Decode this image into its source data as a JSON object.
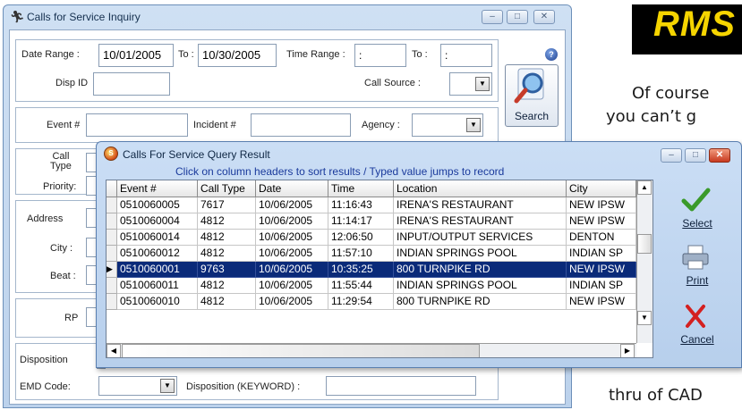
{
  "slide": {
    "banner": "RMS",
    "line1": "Of course",
    "line2": "you can’t g",
    "line3": "thru of CAD"
  },
  "main_window": {
    "title": "Calls for Service Inquiry",
    "date_range_label": "Date Range :",
    "date_from": "10/01/2005",
    "to_label": "To :",
    "date_to": "10/30/2005",
    "time_range_label": "Time Range :",
    "time_from": " :",
    "time_to_label": "To :",
    "time_to": " :",
    "disp_id_label": "Disp ID",
    "call_source_label": "Call Source :",
    "event_label": "Event #",
    "incident_label": "Incident #",
    "agency_label": "Agency :",
    "call_type_label": "Call\nType",
    "priority_label": "Priority:",
    "address_label": "Address",
    "city_label": "City :",
    "beat_label": "Beat :",
    "rp_label": "RP",
    "disposition_label": "Disposition",
    "emd_code_label": "EMD Code:",
    "disposition_keyword_label": "Disposition (KEYWORD) :",
    "search_label": "Search"
  },
  "result_window": {
    "title": "Calls For Service Query Result",
    "hint": "Click on column headers to sort results / Typed value jumps to record",
    "columns": [
      "Event #",
      "Call Type",
      "Date",
      "Time",
      "Location",
      "City"
    ],
    "rows": [
      [
        "0510060005",
        "7617",
        "10/06/2005",
        "11:16:43",
        "IRENA'S RESTAURANT",
        "NEW IPSW"
      ],
      [
        "0510060004",
        "4812",
        "10/06/2005",
        "11:14:17",
        "IRENA'S RESTAURANT",
        "NEW IPSW"
      ],
      [
        "0510060014",
        "4812",
        "10/06/2005",
        "12:06:50",
        "INPUT/OUTPUT SERVICES",
        "DENTON"
      ],
      [
        "0510060012",
        "4812",
        "10/06/2005",
        "11:57:10",
        "INDIAN SPRINGS POOL",
        "INDIAN SP"
      ],
      [
        "0510060001",
        "9763",
        "10/06/2005",
        "10:35:25",
        "800 TURNPIKE RD",
        "NEW IPSW"
      ],
      [
        "0510060011",
        "4812",
        "10/06/2005",
        "11:55:44",
        "INDIAN SPRINGS POOL",
        "INDIAN SP"
      ],
      [
        "0510060010",
        "4812",
        "10/06/2005",
        "11:29:54",
        "800 TURNPIKE RD",
        "NEW IPSW"
      ]
    ],
    "selected_row": 4,
    "actions": {
      "select": "Select",
      "print": "Print",
      "cancel": "Cancel"
    }
  },
  "colors": {
    "banner_bg": "#000000",
    "banner_text": "#f5d400",
    "selection": "#0a2a79",
    "hint_text": "#1a3a9c",
    "select_icon": "#3a9a2a",
    "cancel_icon": "#d42020"
  },
  "icons": {
    "main_title": "runner-icon",
    "help": "help-icon",
    "search": "magnifier-icon",
    "result_title": "app-globe-icon",
    "select": "check-icon",
    "print": "printer-icon",
    "cancel": "x-icon"
  }
}
